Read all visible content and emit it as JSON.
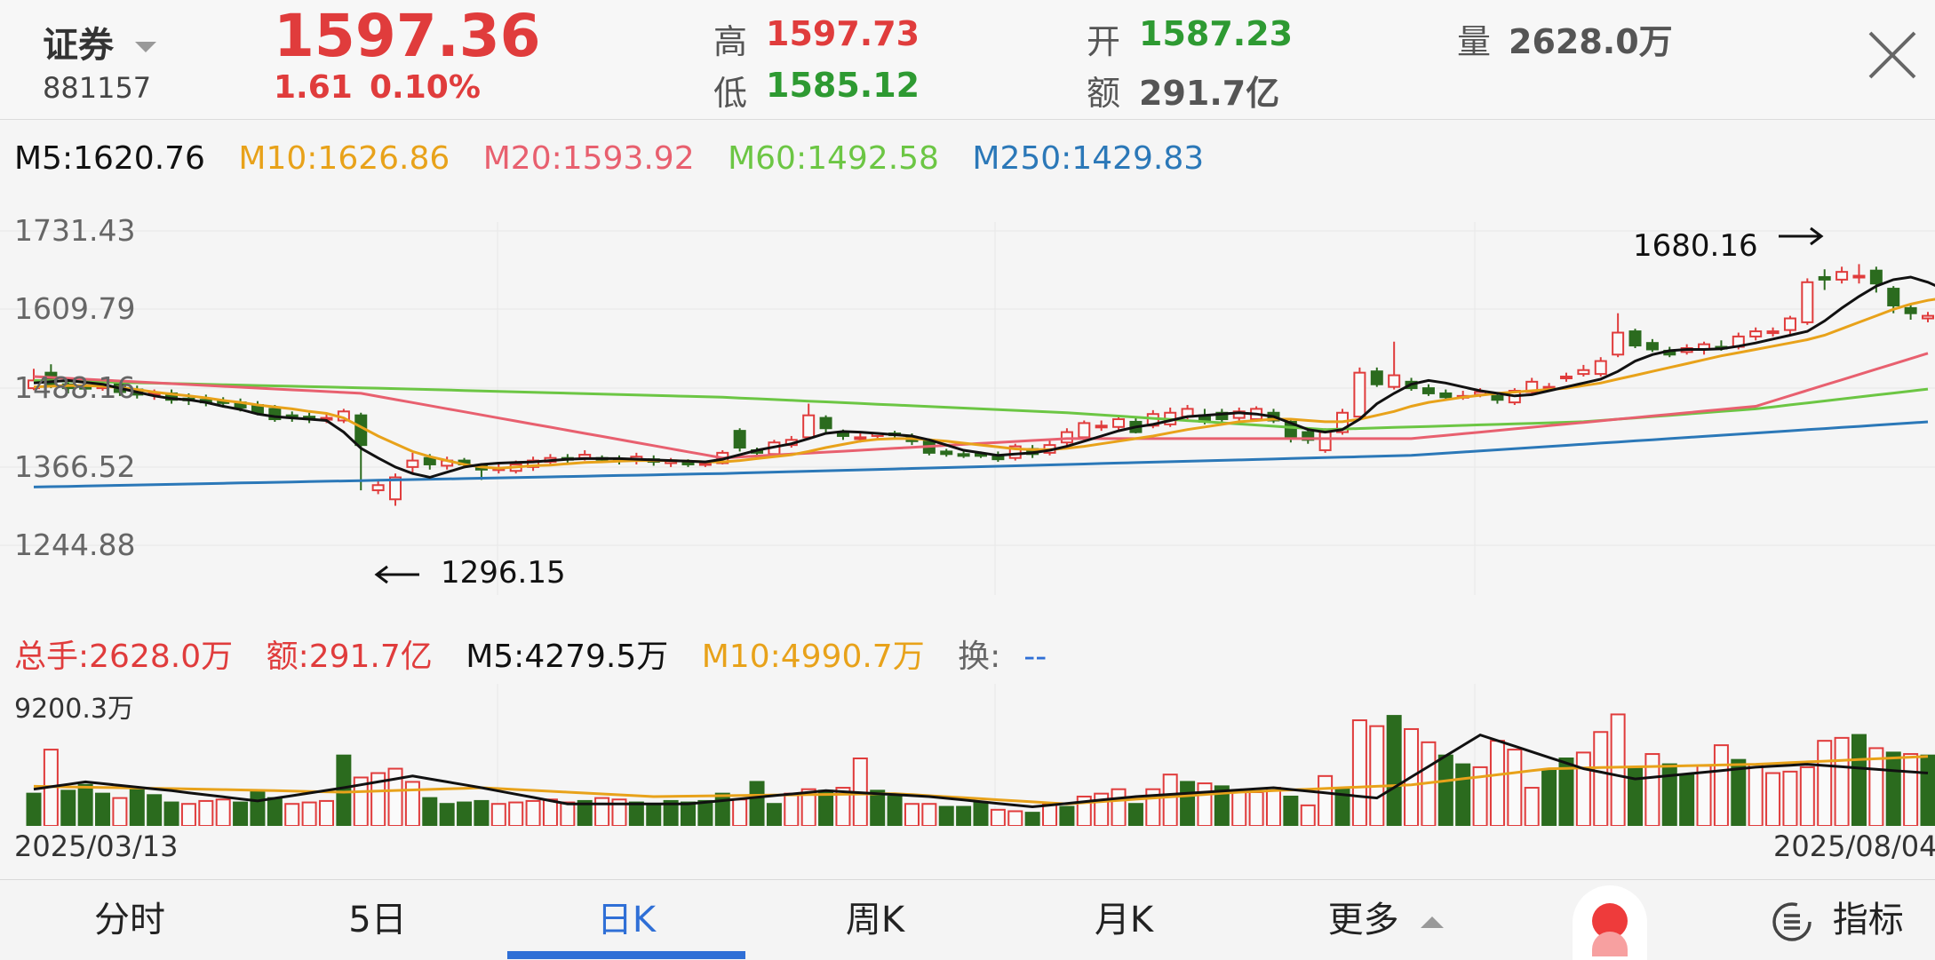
{
  "header": {
    "name": "证券",
    "code": "881157",
    "price": "1597.36",
    "change": "1.61",
    "change_pct": "0.10%",
    "high_label": "高",
    "high": "1597.73",
    "low_label": "低",
    "low": "1585.12",
    "open_label": "开",
    "open": "1587.23",
    "amount_label": "额",
    "amount": "291.7亿",
    "volume_label": "量",
    "volume": "2628.0万"
  },
  "ma_legend": {
    "m5": "M5:1620.76",
    "m10": "M10:1626.86",
    "m20": "M20:1593.92",
    "m60": "M60:1492.58",
    "m250": "M250:1429.83"
  },
  "price_axis": [
    "1731.43",
    "1609.79",
    "1488.16",
    "1366.52",
    "1244.88"
  ],
  "annotations": {
    "high": "1680.16",
    "low": "1296.15"
  },
  "volume_legend": {
    "total": "总手:2628.0万",
    "amount": "额:291.7亿",
    "m5": "M5:4279.5万",
    "m10": "M10:4990.7万",
    "turnover_label": "换:",
    "turnover_value": "--"
  },
  "volume_axis_max": "9200.3万",
  "dates": {
    "start": "2025/03/13",
    "end": "2025/08/04"
  },
  "tabs": [
    "分时",
    "5日",
    "日K",
    "周K",
    "月K",
    "更多"
  ],
  "indicator_label": "指标",
  "colors": {
    "up": "#e03c3c",
    "down": "#2b6b1e",
    "m5": "#111111",
    "m10": "#e8a21a",
    "m20": "#e8606f",
    "m60": "#6cc644",
    "m250": "#2b78b8",
    "accent": "#2f6fd6"
  },
  "chart_data": {
    "type": "candlestick",
    "price_range": [
      1244.88,
      1731.43
    ],
    "volume_max_wan": 9200.3,
    "candles": [
      [
        1488,
        1500,
        1518,
        1485
      ],
      [
        1512,
        1492,
        1525,
        1488
      ],
      [
        1494,
        1488,
        1500,
        1480
      ],
      [
        1490,
        1488,
        1496,
        1482
      ],
      [
        1488,
        1494,
        1500,
        1484
      ],
      [
        1494,
        1482,
        1500,
        1476
      ],
      [
        1486,
        1478,
        1492,
        1472
      ],
      [
        1478,
        1480,
        1486,
        1470
      ],
      [
        1480,
        1470,
        1486,
        1464
      ],
      [
        1472,
        1470,
        1480,
        1462
      ],
      [
        1470,
        1466,
        1478,
        1460
      ],
      [
        1468,
        1465,
        1474,
        1458
      ],
      [
        1466,
        1458,
        1472,
        1452
      ],
      [
        1462,
        1450,
        1468,
        1446
      ],
      [
        1456,
        1440,
        1462,
        1436
      ],
      [
        1446,
        1442,
        1452,
        1436
      ],
      [
        1444,
        1440,
        1450,
        1434
      ],
      [
        1440,
        1442,
        1450,
        1434
      ],
      [
        1438,
        1452,
        1456,
        1434
      ],
      [
        1446,
        1400,
        1450,
        1330
      ],
      [
        1330,
        1338,
        1346,
        1324
      ],
      [
        1316,
        1350,
        1356,
        1306
      ],
      [
        1366,
        1376,
        1388,
        1356
      ],
      [
        1380,
        1370,
        1386,
        1362
      ],
      [
        1368,
        1376,
        1382,
        1362
      ],
      [
        1376,
        1370,
        1380,
        1364
      ],
      [
        1368,
        1362,
        1372,
        1346
      ],
      [
        1362,
        1364,
        1370,
        1356
      ],
      [
        1360,
        1370,
        1376,
        1356
      ],
      [
        1366,
        1376,
        1382,
        1360
      ],
      [
        1374,
        1380,
        1386,
        1368
      ],
      [
        1380,
        1378,
        1386,
        1372
      ],
      [
        1380,
        1385,
        1392,
        1376
      ],
      [
        1380,
        1378,
        1384,
        1372
      ],
      [
        1378,
        1376,
        1384,
        1370
      ],
      [
        1376,
        1382,
        1388,
        1370
      ],
      [
        1378,
        1374,
        1384,
        1368
      ],
      [
        1372,
        1376,
        1380,
        1366
      ],
      [
        1374,
        1370,
        1378,
        1366
      ],
      [
        1370,
        1372,
        1376,
        1366
      ],
      [
        1372,
        1388,
        1392,
        1370
      ],
      [
        1422,
        1396,
        1426,
        1390
      ],
      [
        1392,
        1388,
        1396,
        1382
      ],
      [
        1386,
        1404,
        1408,
        1382
      ],
      [
        1400,
        1408,
        1414,
        1396
      ],
      [
        1412,
        1446,
        1464,
        1408
      ],
      [
        1442,
        1426,
        1446,
        1416
      ],
      [
        1420,
        1414,
        1424,
        1408
      ],
      [
        1410,
        1412,
        1418,
        1404
      ],
      [
        1414,
        1418,
        1420,
        1408
      ],
      [
        1418,
        1416,
        1422,
        1410
      ],
      [
        1412,
        1406,
        1418,
        1400
      ],
      [
        1406,
        1388,
        1410,
        1384
      ],
      [
        1390,
        1386,
        1394,
        1382
      ],
      [
        1386,
        1384,
        1390,
        1380
      ],
      [
        1386,
        1384,
        1390,
        1380
      ],
      [
        1384,
        1378,
        1390,
        1374
      ],
      [
        1380,
        1398,
        1402,
        1376
      ],
      [
        1394,
        1386,
        1400,
        1380
      ],
      [
        1388,
        1400,
        1408,
        1384
      ],
      [
        1404,
        1420,
        1426,
        1398
      ],
      [
        1412,
        1434,
        1438,
        1408
      ],
      [
        1430,
        1430,
        1438,
        1422
      ],
      [
        1428,
        1440,
        1446,
        1424
      ],
      [
        1436,
        1420,
        1442,
        1418
      ],
      [
        1430,
        1448,
        1454,
        1426
      ],
      [
        1432,
        1450,
        1458,
        1428
      ],
      [
        1444,
        1456,
        1462,
        1440
      ],
      [
        1446,
        1436,
        1456,
        1432
      ],
      [
        1450,
        1440,
        1456,
        1436
      ],
      [
        1442,
        1452,
        1458,
        1438
      ],
      [
        1440,
        1456,
        1460,
        1436
      ],
      [
        1450,
        1438,
        1456,
        1434
      ],
      [
        1436,
        1410,
        1440,
        1404
      ],
      [
        1420,
        1408,
        1424,
        1402
      ],
      [
        1392,
        1420,
        1426,
        1388
      ],
      [
        1420,
        1450,
        1456,
        1416
      ],
      [
        1444,
        1512,
        1520,
        1440
      ],
      [
        1514,
        1494,
        1520,
        1490
      ],
      [
        1490,
        1508,
        1560,
        1486
      ],
      [
        1498,
        1488,
        1504,
        1484
      ],
      [
        1488,
        1480,
        1494,
        1476
      ],
      [
        1480,
        1474,
        1486,
        1470
      ],
      [
        1476,
        1476,
        1484,
        1470
      ],
      [
        1478,
        1482,
        1488,
        1474
      ],
      [
        1476,
        1470,
        1480,
        1464
      ],
      [
        1466,
        1484,
        1488,
        1462
      ],
      [
        1482,
        1498,
        1504,
        1478
      ],
      [
        1488,
        1490,
        1496,
        1484
      ],
      [
        1504,
        1506,
        1512,
        1498
      ],
      [
        1510,
        1516,
        1524,
        1506
      ],
      [
        1510,
        1530,
        1536,
        1506
      ],
      [
        1540,
        1574,
        1604,
        1536
      ],
      [
        1576,
        1554,
        1580,
        1550
      ],
      [
        1558,
        1548,
        1564,
        1544
      ],
      [
        1546,
        1540,
        1552,
        1536
      ],
      [
        1544,
        1550,
        1556,
        1540
      ],
      [
        1548,
        1556,
        1560,
        1540
      ],
      [
        1552,
        1550,
        1562,
        1546
      ],
      [
        1552,
        1568,
        1574,
        1548
      ],
      [
        1568,
        1576,
        1582,
        1562
      ],
      [
        1574,
        1576,
        1582,
        1568
      ],
      [
        1578,
        1596,
        1600,
        1572
      ],
      [
        1590,
        1652,
        1658,
        1586
      ],
      [
        1660,
        1656,
        1672,
        1640
      ],
      [
        1656,
        1668,
        1676,
        1650
      ],
      [
        1660,
        1662,
        1680,
        1650
      ],
      [
        1670,
        1650,
        1676,
        1636
      ],
      [
        1642,
        1616,
        1646,
        1604
      ],
      [
        1612,
        1604,
        1618,
        1594
      ],
      [
        1596,
        1600,
        1606,
        1590
      ]
    ],
    "ma5": [
      1496,
      1498,
      1500,
      1497,
      1494,
      1488,
      1482,
      1476,
      1472,
      1470,
      1466,
      1460,
      1455,
      1448,
      1444,
      1442,
      1440,
      1438,
      1420,
      1395,
      1380,
      1366,
      1356,
      1350,
      1358,
      1366,
      1370,
      1372,
      1373,
      1374,
      1376,
      1378,
      1379,
      1379,
      1379,
      1378,
      1377,
      1376,
      1375,
      1374,
      1378,
      1385,
      1392,
      1397,
      1402,
      1410,
      1418,
      1421,
      1420,
      1418,
      1416,
      1414,
      1408,
      1400,
      1392,
      1388,
      1384,
      1386,
      1388,
      1392,
      1398,
      1406,
      1414,
      1422,
      1428,
      1432,
      1438,
      1444,
      1446,
      1448,
      1450,
      1448,
      1444,
      1434,
      1424,
      1420,
      1424,
      1440,
      1464,
      1480,
      1494,
      1500,
      1496,
      1490,
      1484,
      1480,
      1476,
      1478,
      1484,
      1490,
      1496,
      1502,
      1514,
      1530,
      1540,
      1546,
      1548,
      1548,
      1549,
      1553,
      1558,
      1564,
      1570,
      1576,
      1592,
      1612,
      1630,
      1646,
      1656,
      1660,
      1652,
      1640,
      1626,
      1620
    ],
    "ma10": [
      1490,
      1491,
      1492,
      1492,
      1491,
      1489,
      1486,
      1482,
      1479,
      1476,
      1473,
      1469,
      1466,
      1462,
      1459,
      1456,
      1452,
      1449,
      1442,
      1428,
      1414,
      1402,
      1390,
      1382,
      1376,
      1370,
      1366,
      1364,
      1366,
      1368,
      1369,
      1371,
      1373,
      1374,
      1375,
      1376,
      1376,
      1376,
      1375,
      1374,
      1374,
      1376,
      1379,
      1382,
      1385,
      1390,
      1396,
      1401,
      1406,
      1409,
      1410,
      1410,
      1408,
      1406,
      1403,
      1400,
      1397,
      1394,
      1393,
      1393,
      1395,
      1398,
      1402,
      1406,
      1410,
      1414,
      1419,
      1424,
      1428,
      1432,
      1436,
      1438,
      1440,
      1440,
      1438,
      1436,
      1436,
      1440,
      1446,
      1452,
      1460,
      1466,
      1470,
      1474,
      1477,
      1480,
      1482,
      1484,
      1486,
      1488,
      1492,
      1496,
      1502,
      1508,
      1514,
      1520,
      1526,
      1532,
      1538,
      1543,
      1548,
      1553,
      1558,
      1563,
      1570,
      1580,
      1590,
      1600,
      1610,
      1618,
      1624,
      1628,
      1630,
      1626
    ],
    "ma20_points": [
      [
        0,
        1506
      ],
      [
        19,
        1480
      ],
      [
        40,
        1380
      ],
      [
        60,
        1410
      ],
      [
        80,
        1410
      ],
      [
        100,
        1460
      ],
      [
        115,
        1583
      ],
      [
        117,
        1598
      ]
    ],
    "ma60_points": [
      [
        0,
        1500
      ],
      [
        20,
        1488
      ],
      [
        40,
        1474
      ],
      [
        60,
        1450
      ],
      [
        75,
        1424
      ],
      [
        90,
        1436
      ],
      [
        100,
        1456
      ],
      [
        117,
        1508
      ]
    ],
    "ma250_points": [
      [
        0,
        1335
      ],
      [
        40,
        1356
      ],
      [
        80,
        1384
      ],
      [
        117,
        1448
      ]
    ],
    "volumes": [
      [
        2200,
        1
      ],
      [
        5200,
        0
      ],
      [
        2400,
        1
      ],
      [
        2800,
        1
      ],
      [
        2200,
        1
      ],
      [
        1900,
        0
      ],
      [
        2600,
        1
      ],
      [
        2100,
        1
      ],
      [
        1600,
        1
      ],
      [
        1500,
        0
      ],
      [
        1700,
        0
      ],
      [
        1800,
        0
      ],
      [
        1600,
        1
      ],
      [
        2400,
        1
      ],
      [
        1900,
        1
      ],
      [
        1500,
        0
      ],
      [
        1600,
        0
      ],
      [
        1700,
        0
      ],
      [
        4800,
        1
      ],
      [
        3300,
        0
      ],
      [
        3600,
        0
      ],
      [
        3900,
        0
      ],
      [
        3000,
        0
      ],
      [
        1900,
        1
      ],
      [
        1500,
        1
      ],
      [
        1600,
        1
      ],
      [
        1700,
        1
      ],
      [
        1500,
        0
      ],
      [
        1600,
        0
      ],
      [
        1700,
        0
      ],
      [
        1800,
        0
      ],
      [
        1600,
        0
      ],
      [
        1700,
        1
      ],
      [
        1900,
        0
      ],
      [
        1800,
        0
      ],
      [
        1600,
        1
      ],
      [
        1500,
        1
      ],
      [
        1700,
        1
      ],
      [
        1600,
        1
      ],
      [
        1700,
        1
      ],
      [
        2200,
        1
      ],
      [
        1800,
        0
      ],
      [
        3000,
        1
      ],
      [
        1500,
        1
      ],
      [
        2200,
        0
      ],
      [
        2500,
        0
      ],
      [
        2400,
        1
      ],
      [
        2600,
        0
      ],
      [
        4600,
        0
      ],
      [
        2400,
        1
      ],
      [
        2000,
        1
      ],
      [
        1500,
        0
      ],
      [
        1500,
        0
      ],
      [
        1300,
        1
      ],
      [
        1300,
        1
      ],
      [
        1600,
        1
      ],
      [
        1100,
        0
      ],
      [
        1000,
        0
      ],
      [
        900,
        1
      ],
      [
        1500,
        0
      ],
      [
        1300,
        1
      ],
      [
        2000,
        0
      ],
      [
        2200,
        0
      ],
      [
        2500,
        0
      ],
      [
        1500,
        1
      ],
      [
        2500,
        0
      ],
      [
        3500,
        0
      ],
      [
        3000,
        1
      ],
      [
        2900,
        0
      ],
      [
        2700,
        1
      ],
      [
        2300,
        0
      ],
      [
        2300,
        0
      ],
      [
        2600,
        0
      ],
      [
        2000,
        1
      ],
      [
        1400,
        0
      ],
      [
        3400,
        0
      ],
      [
        2500,
        1
      ],
      [
        7200,
        0
      ],
      [
        6800,
        0
      ],
      [
        7500,
        1
      ],
      [
        6600,
        0
      ],
      [
        5700,
        0
      ],
      [
        4800,
        1
      ],
      [
        4200,
        1
      ],
      [
        4000,
        0
      ],
      [
        5800,
        0
      ],
      [
        5200,
        0
      ],
      [
        2600,
        0
      ],
      [
        3800,
        1
      ],
      [
        4600,
        1
      ],
      [
        5000,
        0
      ],
      [
        6400,
        0
      ],
      [
        7600,
        0
      ],
      [
        3900,
        1
      ],
      [
        4900,
        0
      ],
      [
        4200,
        1
      ],
      [
        3500,
        1
      ],
      [
        4100,
        0
      ],
      [
        5500,
        0
      ],
      [
        4500,
        1
      ],
      [
        4200,
        0
      ],
      [
        3600,
        0
      ],
      [
        3700,
        0
      ],
      [
        4000,
        0
      ],
      [
        5800,
        0
      ],
      [
        6000,
        0
      ],
      [
        6200,
        1
      ],
      [
        5300,
        0
      ],
      [
        5000,
        1
      ],
      [
        4900,
        0
      ],
      [
        4800,
        1
      ],
      [
        3600,
        1
      ],
      [
        2600,
        0
      ]
    ],
    "vol_m5_points": [
      [
        0,
        2500
      ],
      [
        3,
        3000
      ],
      [
        8,
        2400
      ],
      [
        13,
        1700
      ],
      [
        18,
        2600
      ],
      [
        22,
        3400
      ],
      [
        26,
        2600
      ],
      [
        31,
        1500
      ],
      [
        38,
        1500
      ],
      [
        46,
        2400
      ],
      [
        52,
        2000
      ],
      [
        58,
        1300
      ],
      [
        64,
        2000
      ],
      [
        72,
        2600
      ],
      [
        78,
        1900
      ],
      [
        84,
        6200
      ],
      [
        90,
        3900
      ],
      [
        93,
        3200
      ],
      [
        100,
        4000
      ],
      [
        103,
        4200
      ],
      [
        110,
        3600
      ],
      [
        113,
        3600
      ],
      [
        118,
        3300
      ]
    ],
    "vol_m10_points": [
      [
        0,
        2700
      ],
      [
        10,
        2500
      ],
      [
        18,
        2300
      ],
      [
        26,
        2600
      ],
      [
        36,
        2000
      ],
      [
        50,
        2200
      ],
      [
        60,
        1500
      ],
      [
        70,
        2300
      ],
      [
        80,
        2800
      ],
      [
        88,
        3900
      ],
      [
        100,
        4200
      ],
      [
        113,
        4900
      ],
      [
        118,
        4800
      ]
    ]
  }
}
